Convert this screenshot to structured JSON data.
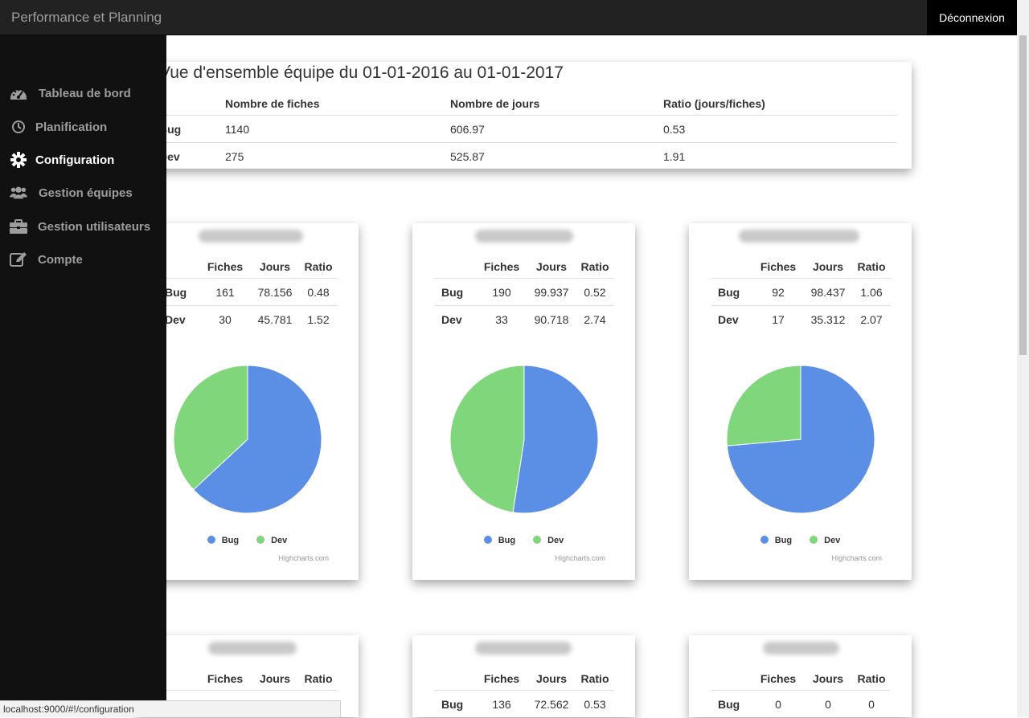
{
  "app": {
    "title": "Performance et Planning",
    "logout_label": "Déconnexion"
  },
  "sidebar": {
    "items": [
      {
        "label": "Tableau de bord",
        "icon": "dashboard-icon",
        "active": false
      },
      {
        "label": "Planification",
        "icon": "clock-icon",
        "active": false
      },
      {
        "label": "Configuration",
        "icon": "gear-icon",
        "active": true
      },
      {
        "label": "Gestion équipes",
        "icon": "users-icon",
        "active": false
      },
      {
        "label": "Gestion utilisateurs",
        "icon": "briefcase-icon",
        "active": false
      },
      {
        "label": "Compte",
        "icon": "edit-icon",
        "active": false
      }
    ]
  },
  "overview": {
    "title": "Vue d'ensemble équipe du 01-01-2016 au 01-01-2017",
    "headers": [
      "",
      "Nombre de fiches",
      "Nombre de jours",
      "Ratio (jours/fiches)"
    ],
    "rows": [
      [
        "Bug",
        "1140",
        "606.97",
        "0.53"
      ],
      [
        "Dev",
        "275",
        "525.87",
        "1.91"
      ]
    ]
  },
  "cards": {
    "headers": [
      "",
      "Fiches",
      "Jours",
      "Ratio"
    ],
    "legend": [
      "Bug",
      "Dev"
    ],
    "credits": "Highcharts.com",
    "colors": {
      "bug": "#5b8fe6",
      "dev": "#80d67a"
    },
    "items": [
      {
        "rows": [
          [
            "Bug",
            "161",
            "78.156",
            "0.48"
          ],
          [
            "Dev",
            "30",
            "45.781",
            "1.52"
          ]
        ],
        "pie": [
          78.156,
          45.781
        ]
      },
      {
        "rows": [
          [
            "Bug",
            "190",
            "99.937",
            "0.52"
          ],
          [
            "Dev",
            "33",
            "90.718",
            "2.74"
          ]
        ],
        "pie": [
          99.937,
          90.718
        ]
      },
      {
        "rows": [
          [
            "Bug",
            "92",
            "98.437",
            "1.06"
          ],
          [
            "Dev",
            "17",
            "35.312",
            "2.07"
          ]
        ],
        "pie": [
          98.437,
          35.312
        ]
      },
      {
        "rows": [],
        "pie": []
      },
      {
        "rows": [
          [
            "Bug",
            "136",
            "72.562",
            "0.53"
          ]
        ],
        "pie": []
      },
      {
        "rows": [
          [
            "Bug",
            "0",
            "0",
            "0"
          ]
        ],
        "pie": []
      }
    ]
  },
  "status_url": "localhost:9000/#!/configuration"
}
